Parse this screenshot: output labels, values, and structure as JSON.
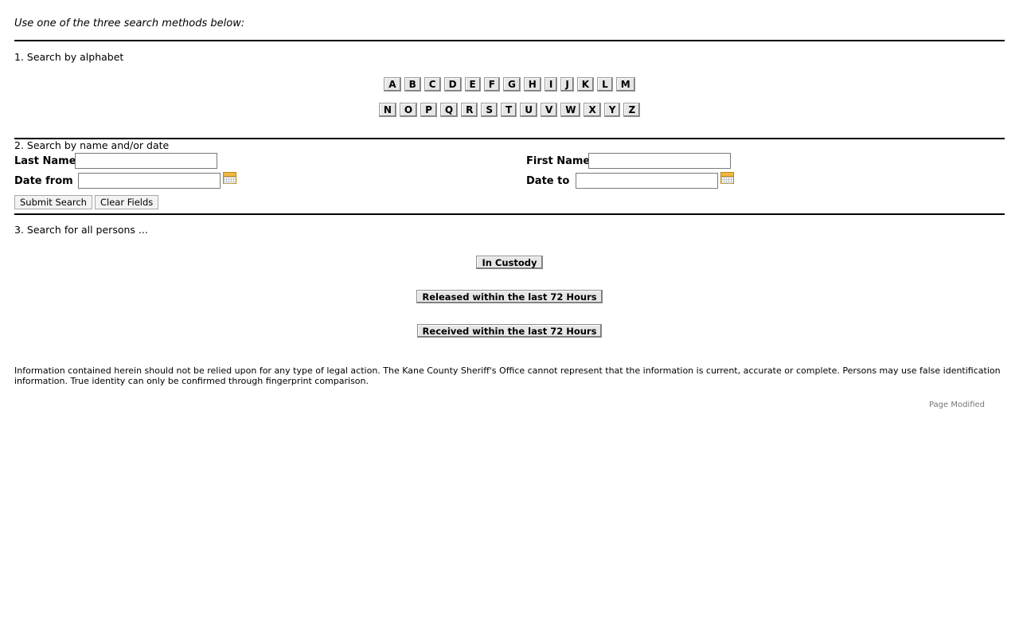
{
  "intro": "Use one of the three search methods below:",
  "section1": {
    "title": "1. Search by alphabet",
    "row1": [
      "A",
      "B",
      "C",
      "D",
      "E",
      "F",
      "G",
      "H",
      "I",
      "J",
      "K",
      "L",
      "M"
    ],
    "row2": [
      "N",
      "O",
      "P",
      "Q",
      "R",
      "S",
      "T",
      "U",
      "V",
      "W",
      "X",
      "Y",
      "Z"
    ]
  },
  "section2": {
    "title": "2. Search by name and/or date",
    "last_name_label": "Last Name",
    "first_name_label": "First Name",
    "date_from_label": "Date from",
    "date_to_label": "Date to",
    "last_name_value": "",
    "first_name_value": "",
    "date_from_value": "",
    "date_to_value": "",
    "submit_label": "Submit Search",
    "clear_label": "Clear Fields"
  },
  "section3": {
    "title": "3. Search for all persons ...",
    "in_custody_label": "In Custody",
    "released_label": "Released within the last 72 Hours",
    "received_label": "Received within the last 72 Hours"
  },
  "footer": {
    "disclaimer": "Information contained herein should not be relied upon for any type of legal action.  The Kane County Sheriff's Office cannot represent that the information is current, accurate or complete.  Persons may use false identification information.  True identity can only be confirmed through fingerprint comparison.",
    "modified": "Page Modified"
  },
  "icons": {
    "calendar": "calendar-icon"
  }
}
